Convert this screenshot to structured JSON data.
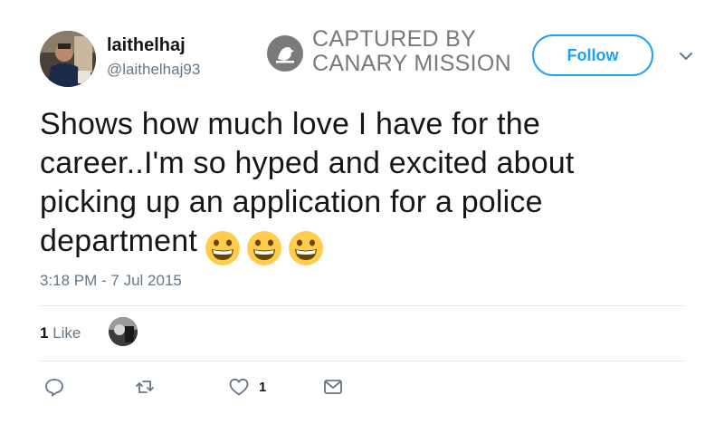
{
  "user": {
    "display_name": "laithelhaj",
    "handle": "@laithelhaj93"
  },
  "watermark": {
    "line1": "CAPTURED BY",
    "line2": "CANARY MISSION"
  },
  "follow_button": {
    "label": "Follow"
  },
  "tweet": {
    "text": "Shows how much love I have for the career..I'm so hyped and excited about picking up an application for a police department",
    "emojis": [
      "grinning-face",
      "grinning-face",
      "grinning-face"
    ],
    "timestamp": "3:18 PM - 7 Jul 2015"
  },
  "engagement": {
    "like_count": "1",
    "like_label": "Like"
  },
  "actions": {
    "reply_icon": "reply-icon",
    "retweet_icon": "retweet-icon",
    "like_icon": "heart-icon",
    "like_count": "1",
    "message_icon": "envelope-icon"
  },
  "colors": {
    "accent": "#1da1f2",
    "secondary_text": "#657786",
    "watermark": "#7a7a7a",
    "emoji": "#ffcc4d"
  }
}
